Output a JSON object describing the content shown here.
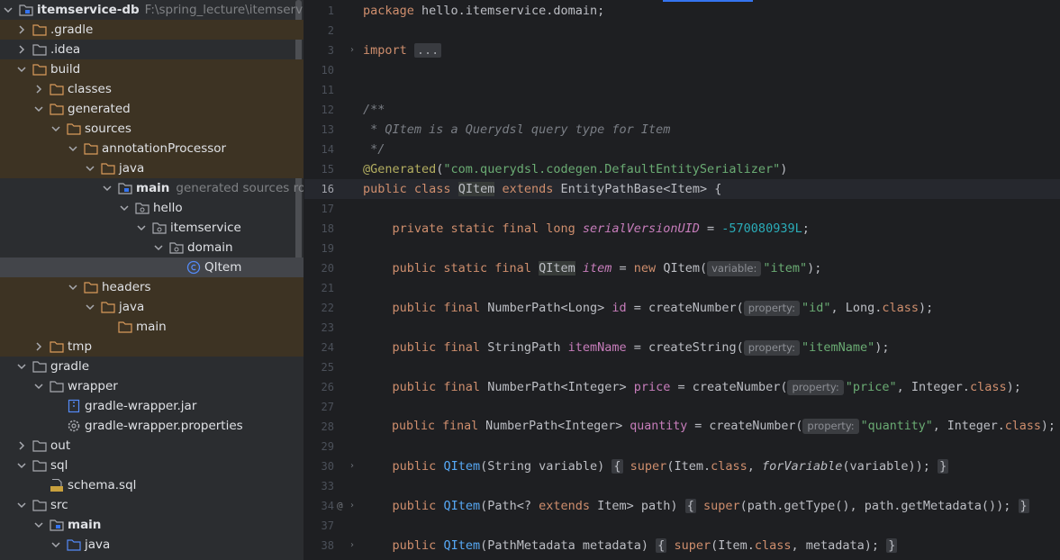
{
  "project_tree": {
    "root": {
      "label": "itemservice-db",
      "path": "F:\\spring_lecture\\itemservice-db"
    },
    "items": [
      {
        "label": ".gradle"
      },
      {
        "label": ".idea"
      },
      {
        "label": "build"
      },
      {
        "label": "classes"
      },
      {
        "label": "generated"
      },
      {
        "label": "sources"
      },
      {
        "label": "annotationProcessor"
      },
      {
        "label": "java"
      },
      {
        "label": "main",
        "hint": "generated sources root"
      },
      {
        "label": "hello"
      },
      {
        "label": "itemservice"
      },
      {
        "label": "domain"
      },
      {
        "label": "QItem"
      },
      {
        "label": "headers"
      },
      {
        "label": "java"
      },
      {
        "label": "main"
      },
      {
        "label": "tmp"
      },
      {
        "label": "gradle"
      },
      {
        "label": "wrapper"
      },
      {
        "label": "gradle-wrapper.jar"
      },
      {
        "label": "gradle-wrapper.properties"
      },
      {
        "label": "out"
      },
      {
        "label": "sql"
      },
      {
        "label": "schema.sql"
      },
      {
        "label": "src"
      },
      {
        "label": "main"
      },
      {
        "label": "java"
      }
    ]
  },
  "editor": {
    "line_numbers": [
      "1",
      "2",
      "3",
      "10",
      "11",
      "12",
      "13",
      "14",
      "15",
      "16",
      "17",
      "18",
      "19",
      "20",
      "21",
      "22",
      "23",
      "24",
      "25",
      "26",
      "27",
      "28",
      "29",
      "30",
      "33",
      "34",
      "37",
      "38"
    ],
    "current_line": "16",
    "gutter_mark": "@",
    "code": {
      "l1_kw": "package",
      "l1_rest": " hello.itemservice.domain;",
      "l3_kw": "import",
      "l3_fold": "...",
      "l12": "/**",
      "l13": " * QItem is a Querydsl query type for Item",
      "l14": " */",
      "l15_ann": "@Generated",
      "l15_p1": "(",
      "l15_str": "\"com.querydsl.codegen.DefaultEntitySerializer\"",
      "l15_p2": ")",
      "l16_kw1": "public class",
      "l16_cls": "QItem",
      "l16_kw2": "extends",
      "l16_rest": "EntityPathBase<Item> {",
      "l18_kw": "private static final long",
      "l18_fld": "serialVersionUID",
      "l18_eq": " = ",
      "l18_num": "-570080939L",
      "l18_end": ";",
      "l20_kw": "public static final",
      "l20_type": "QItem",
      "l20_fld": "item",
      "l20_eq": " = ",
      "l20_new": "new",
      "l20_ctor": "QItem(",
      "l20_hint": "variable:",
      "l20_str": "\"item\"",
      "l20_end": ");",
      "l22_kw": "public final",
      "l22_type": "NumberPath<Long>",
      "l22_fld": "id",
      "l22_call": " = createNumber(",
      "l22_hint": "property:",
      "l22_str": "\"id\"",
      "l22_mid": ", Long.",
      "l22_cls": "class",
      "l22_end": ");",
      "l24_kw": "public final",
      "l24_type": "StringPath",
      "l24_fld": "itemName",
      "l24_call": " = createString(",
      "l24_hint": "property:",
      "l24_str": "\"itemName\"",
      "l24_end": ");",
      "l26_kw": "public final",
      "l26_type": "NumberPath<Integer>",
      "l26_fld": "price",
      "l26_call": " = createNumber(",
      "l26_hint": "property:",
      "l26_str": "\"price\"",
      "l26_mid": ", Integer.",
      "l26_cls": "class",
      "l26_end": ");",
      "l28_kw": "public final",
      "l28_type": "NumberPath<Integer>",
      "l28_fld": "quantity",
      "l28_call": " = createNumber(",
      "l28_hint": "property:",
      "l28_str": "\"quantity\"",
      "l28_mid": ", Integer.",
      "l28_cls": "class",
      "l28_end": ");",
      "l30_kw": "public",
      "l30_fn": "QItem",
      "l30_params": "(String variable)",
      "l30_ob": "{",
      "l30_super": "super",
      "l30_a": "(Item.",
      "l30_cls": "class",
      "l30_b": ", ",
      "l30_it": "forVariable",
      "l30_c": "(variable));",
      "l30_cb": "}",
      "l34_kw": "public",
      "l34_fn": "QItem",
      "l34_p1": "(Path<? ",
      "l34_ext": "extends",
      "l34_p2": " Item> path)",
      "l34_ob": "{",
      "l34_super": "super",
      "l34_body": "(path.getType(), path.getMetadata());",
      "l34_cb": "}",
      "l38_kw": "public",
      "l38_fn": "QItem",
      "l38_params": "(PathMetadata metadata)",
      "l38_ob": "{",
      "l38_super": "super",
      "l38_a": "(Item.",
      "l38_cls": "class",
      "l38_b": ", metadata);",
      "l38_cb": "}"
    }
  },
  "colors": {
    "keyword": "#cf8e6d",
    "string": "#6aab73",
    "number": "#2aacb8",
    "comment": "#7a7e85",
    "annotation": "#b3ae60",
    "field": "#c77dbb",
    "method": "#56a8f5",
    "highlight_row": "#3d3323"
  }
}
